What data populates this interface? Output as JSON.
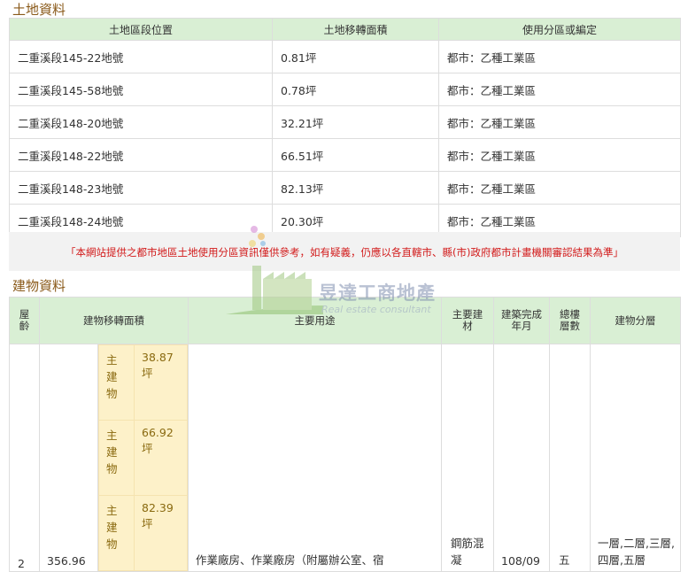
{
  "land": {
    "title": "土地資料",
    "headers": [
      "土地區段位置",
      "土地移轉面積",
      "使用分區或編定"
    ],
    "rows": [
      [
        "二重溪段145-22地號",
        "0.81坪",
        "都市：乙種工業區"
      ],
      [
        "二重溪段145-58地號",
        "0.78坪",
        "都市：乙種工業區"
      ],
      [
        "二重溪段148-20地號",
        "32.21坪",
        "都市：乙種工業區"
      ],
      [
        "二重溪段148-22地號",
        "66.51坪",
        "都市：乙種工業區"
      ],
      [
        "二重溪段148-23地號",
        "82.13坪",
        "都市：乙種工業區"
      ],
      [
        "二重溪段148-24地號",
        "20.30坪",
        "都市：乙種工業區"
      ]
    ]
  },
  "notice": "「本網站提供之都市地區土地使用分區資訊僅供參考，如有疑義，仍應以各直轄市、縣(市)政府都市計畫機關審認結果為準」",
  "watermark": {
    "name": "昱達工商地產",
    "sub": "Real estate consultant"
  },
  "building": {
    "title": "建物資料",
    "headers": {
      "age": "屋齡",
      "area": "建物移轉面積",
      "usage": "主要用途",
      "material": "主要建材",
      "completed": "建築完成年月",
      "floors": "總樓層數",
      "layers": "建物分層"
    },
    "row": {
      "age": "2",
      "area_total": "356.96",
      "sub_items": [
        {
          "label": "主建物",
          "value": "38.87坪"
        },
        {
          "label": "主建物",
          "value": "66.92坪"
        },
        {
          "label": "主建物",
          "value": "82.39坪"
        }
      ],
      "usage": "作業廠房、作業廠房（附屬辦公室、宿",
      "material": "鋼筋混凝",
      "completed": "108/09",
      "floors": "五",
      "layers": "一層,二層,三層,四層,五層"
    }
  }
}
